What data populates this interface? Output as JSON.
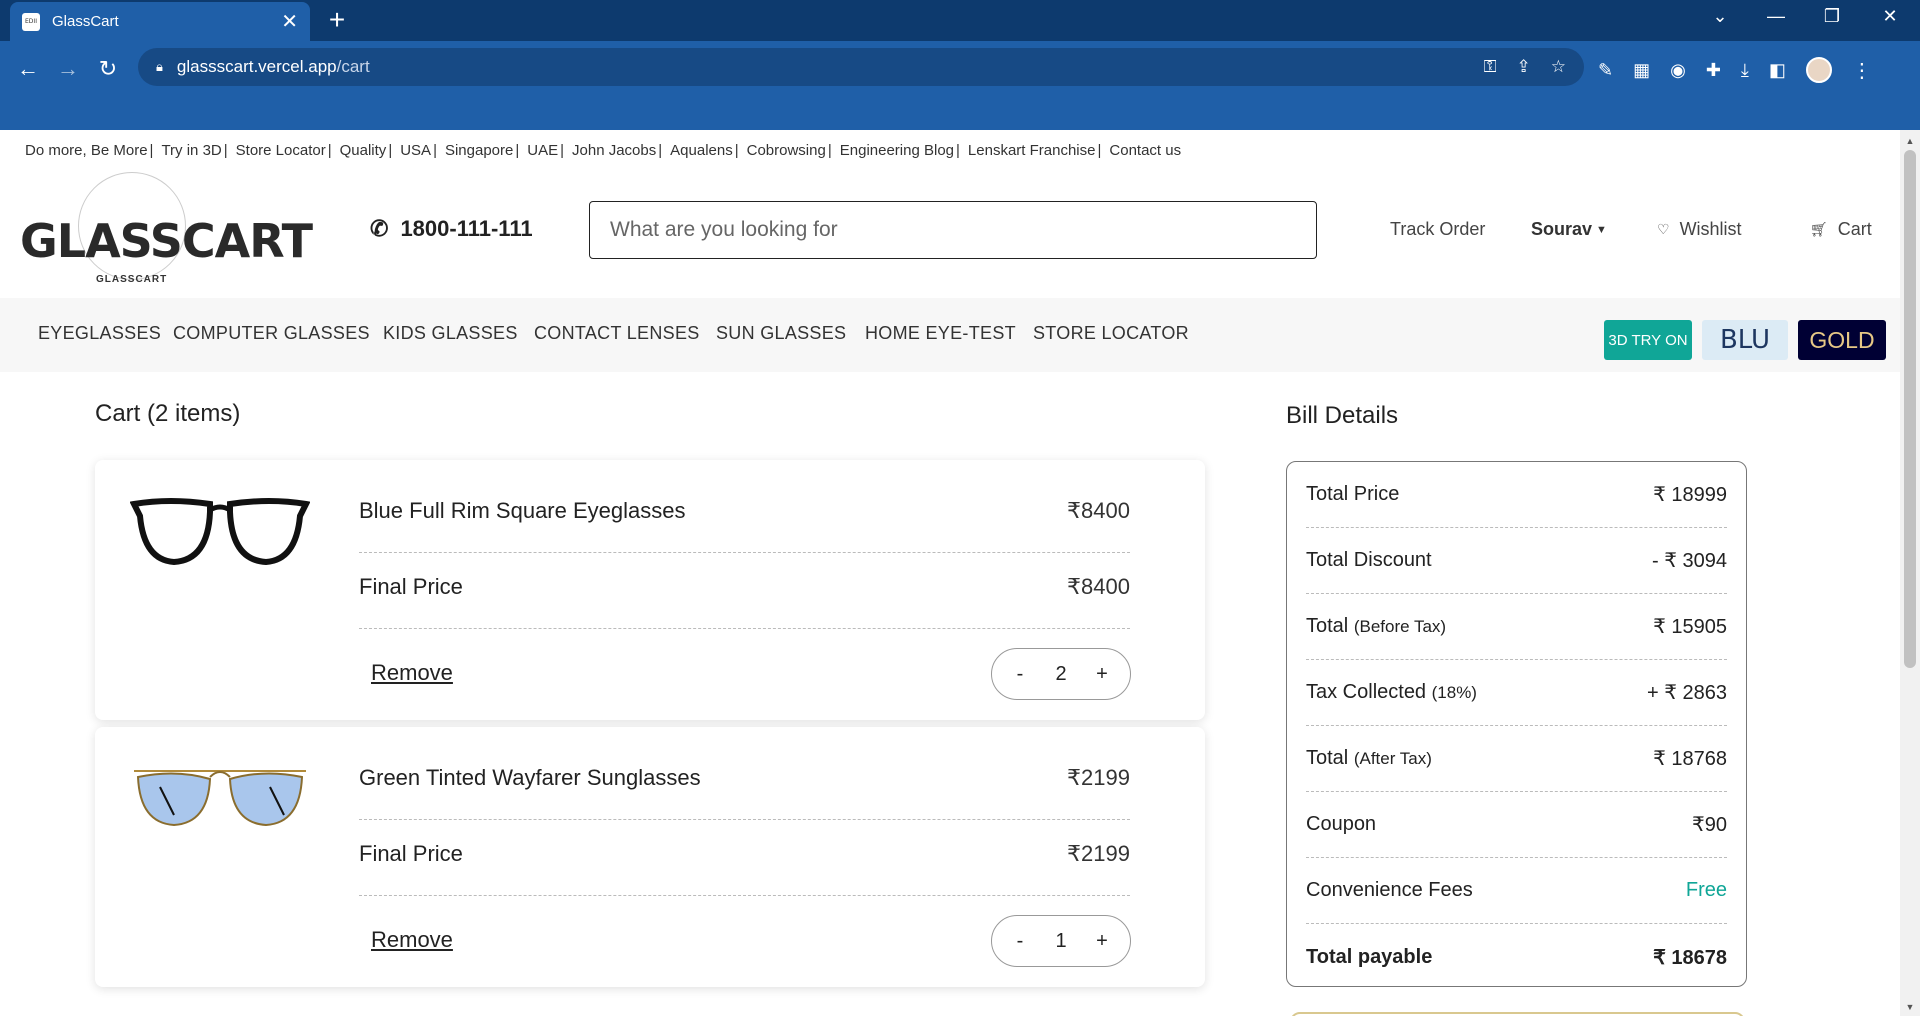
{
  "browser": {
    "tab_title": "GlassCart",
    "favicon_text": "EDII",
    "url_host": "glassscart.vercel.app",
    "url_path": "/cart"
  },
  "top_links": [
    "Do more, Be More",
    "Try in 3D",
    "Store Locator",
    "Quality",
    "USA",
    "Singapore",
    "UAE",
    "John Jacobs",
    "Aqualens",
    "Cobrowsing",
    "Engineering Blog",
    "Lenskart Franchise",
    "Contact us"
  ],
  "header": {
    "logo_text": "GLASSCART",
    "logo_sub": "GLASSCART",
    "phone": "1800-111-111",
    "search_placeholder": "What are you looking for",
    "track_order": "Track Order",
    "user": "Sourav",
    "wishlist": "Wishlist",
    "cart": "Cart"
  },
  "categories": [
    "EYEGLASSES",
    "COMPUTER GLASSES",
    "KIDS GLASSES",
    "CONTACT LENSES",
    "SUN GLASSES",
    "HOME EYE-TEST",
    "STORE LOCATOR"
  ],
  "promo": {
    "try_on": "3D TRY ON",
    "blu": "BLU",
    "gold": "GOLD"
  },
  "cart": {
    "title": "Cart (2 items)",
    "items": [
      {
        "name": "Blue Full Rim Square Eyeglasses",
        "price": "₹8400",
        "final_label": "Final Price",
        "final_price": "₹8400",
        "remove": "Remove",
        "qty": "2",
        "minus": "-",
        "plus": "+"
      },
      {
        "name": "Green Tinted Wayfarer Sunglasses",
        "price": "₹2199",
        "final_label": "Final Price",
        "final_price": "₹2199",
        "remove": "Remove",
        "qty": "1",
        "minus": "-",
        "plus": "+"
      }
    ]
  },
  "bill": {
    "title": "Bill Details",
    "rows": [
      {
        "label": "Total Price",
        "paren": "",
        "value": "₹ 18999"
      },
      {
        "label": "Total Discount",
        "paren": "",
        "value": "- ₹ 3094"
      },
      {
        "label": "Total",
        "paren": "(Before Tax)",
        "value": "₹ 15905"
      },
      {
        "label": "Tax Collected",
        "paren": "(18%)",
        "value": "+ ₹ 2863"
      },
      {
        "label": "Total",
        "paren": "(After Tax)",
        "value": "₹ 18768"
      },
      {
        "label": "Coupon",
        "paren": "",
        "value": "₹90"
      },
      {
        "label": "Convenience Fees",
        "paren": "",
        "value": "Free"
      },
      {
        "label": "Total payable",
        "paren": "",
        "value": "₹ 18678"
      }
    ]
  },
  "colors": {
    "chrome_dark": "#0d3a6e",
    "chrome": "#1f5fa8",
    "teal": "#10a697",
    "gold_bg": "#000034"
  }
}
